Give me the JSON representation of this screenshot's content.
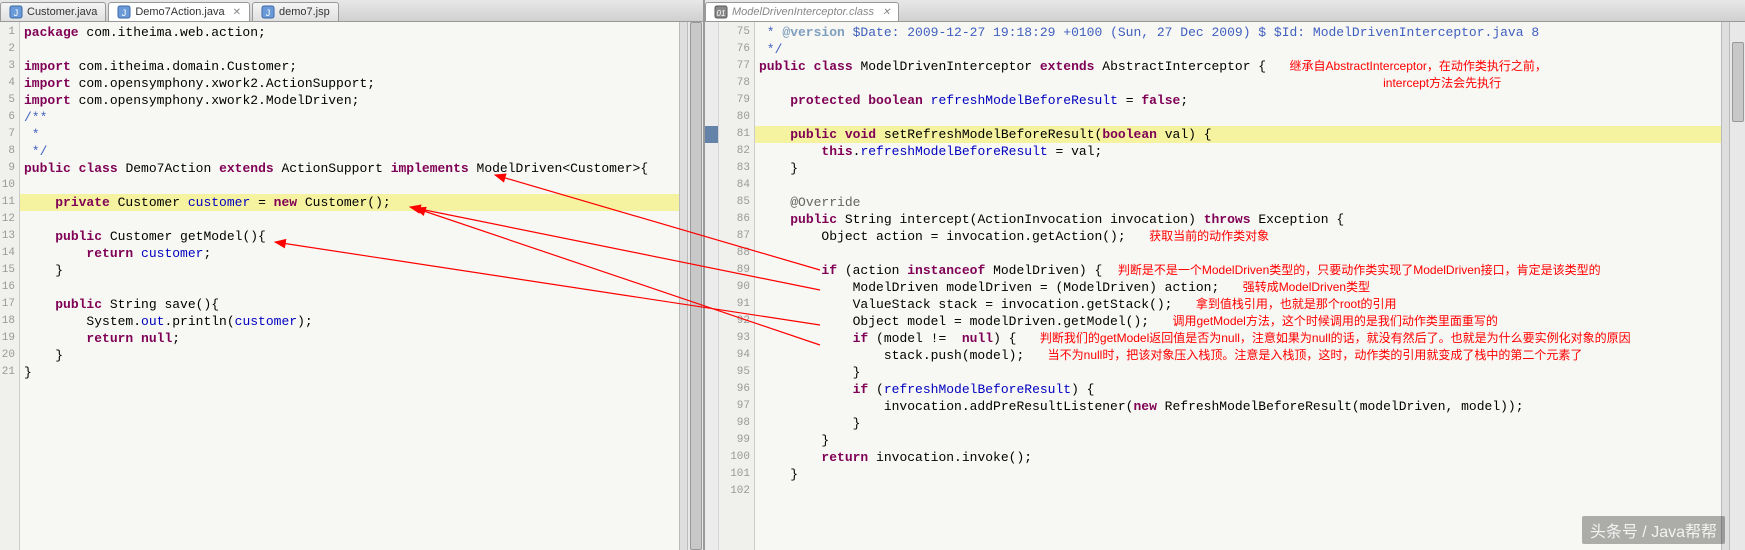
{
  "tabs_left": [
    {
      "label": "Customer.java",
      "active": false
    },
    {
      "label": "Demo7Action.java",
      "active": true
    },
    {
      "label": "demo7.jsp",
      "active": false
    }
  ],
  "tabs_right": [
    {
      "label": "ModelDrivenInterceptor.class",
      "active": true
    }
  ],
  "left_start_line": 1,
  "right_start_line": 75,
  "left_lines": [
    [
      [
        "kw",
        "package"
      ],
      [
        "",
        " com.itheima.web.action;"
      ]
    ],
    [],
    [
      [
        "kw",
        "import"
      ],
      [
        "",
        " com.itheima.domain.Customer;"
      ]
    ],
    [
      [
        "kw",
        "import"
      ],
      [
        "",
        " com.opensymphony.xwork2.ActionSupport;"
      ]
    ],
    [
      [
        "kw",
        "import"
      ],
      [
        "",
        " com.opensymphony.xwork2.ModelDriven;"
      ]
    ],
    [
      [
        "doc",
        "/**"
      ]
    ],
    [
      [
        "doc",
        " *"
      ]
    ],
    [
      [
        "doc",
        " */"
      ]
    ],
    [
      [
        "kw",
        "public"
      ],
      [
        "",
        " "
      ],
      [
        "kw",
        "class"
      ],
      [
        "",
        " Demo7Action "
      ],
      [
        "kw",
        "extends"
      ],
      [
        "",
        " ActionSupport "
      ],
      [
        "kw",
        "implements"
      ],
      [
        "",
        " ModelDriven<Customer>{"
      ]
    ],
    [],
    [
      [
        "",
        "    "
      ],
      [
        "kw",
        "private"
      ],
      [
        "",
        " Customer "
      ],
      [
        "fld",
        "customer"
      ],
      [
        "",
        " = "
      ],
      [
        "kw",
        "new"
      ],
      [
        "",
        " Customer();"
      ]
    ],
    [],
    [
      [
        "",
        "    "
      ],
      [
        "kw",
        "public"
      ],
      [
        "",
        " Customer getModel(){"
      ]
    ],
    [
      [
        "",
        "        "
      ],
      [
        "kw",
        "return"
      ],
      [
        "",
        " "
      ],
      [
        "fld",
        "customer"
      ],
      [
        "",
        ";"
      ]
    ],
    [
      [
        "",
        "    }"
      ]
    ],
    [],
    [
      [
        "",
        "    "
      ],
      [
        "kw",
        "public"
      ],
      [
        "",
        " String save(){"
      ]
    ],
    [
      [
        "",
        "        System."
      ],
      [
        "fld",
        "out"
      ],
      [
        "",
        ".println("
      ],
      [
        "fld",
        "customer"
      ],
      [
        "",
        ");"
      ]
    ],
    [
      [
        "",
        "        "
      ],
      [
        "kw",
        "return"
      ],
      [
        "",
        " "
      ],
      [
        "kw",
        "null"
      ],
      [
        "",
        ";"
      ]
    ],
    [
      [
        "",
        "    }"
      ]
    ],
    [
      [
        "",
        "}"
      ]
    ]
  ],
  "left_hl": [
    11
  ],
  "right_lines": [
    [
      [
        "doc",
        " * "
      ],
      [
        "doctag",
        "@version"
      ],
      [
        "doc",
        " $Date: 2009-12-27 19:18:29 +0100 (Sun, 27 Dec 2009) $ $Id: ModelDrivenInterceptor.java 8"
      ]
    ],
    [
      [
        "doc",
        " */"
      ]
    ],
    [
      [
        "kw",
        "public"
      ],
      [
        "",
        " "
      ],
      [
        "kw",
        "class"
      ],
      [
        "",
        " ModelDrivenInterceptor "
      ],
      [
        "kw",
        "extends"
      ],
      [
        "",
        " AbstractInterceptor {   "
      ],
      [
        "ann-red",
        "继承自AbstractInterceptor，在动作类执行之前，"
      ]
    ],
    [
      [
        "",
        "                                                                                "
      ],
      [
        "ann-red",
        "intercept方法会先执行"
      ]
    ],
    [
      [
        "",
        "    "
      ],
      [
        "kw",
        "protected"
      ],
      [
        "",
        " "
      ],
      [
        "kw",
        "boolean"
      ],
      [
        "",
        " "
      ],
      [
        "fld",
        "refreshModelBeforeResult"
      ],
      [
        "",
        " = "
      ],
      [
        "kw",
        "false"
      ],
      [
        "",
        ";"
      ]
    ],
    [],
    [
      [
        "",
        "    "
      ],
      [
        "kw",
        "public"
      ],
      [
        "",
        " "
      ],
      [
        "kw",
        "void"
      ],
      [
        "",
        " setRefreshModelBeforeResult("
      ],
      [
        "kw",
        "boolean"
      ],
      [
        "",
        " val) {"
      ]
    ],
    [
      [
        "",
        "        "
      ],
      [
        "kw",
        "this"
      ],
      [
        "",
        "."
      ],
      [
        "fld",
        "refreshModelBeforeResult"
      ],
      [
        "",
        " = val;"
      ]
    ],
    [
      [
        "",
        "    }"
      ]
    ],
    [],
    [
      [
        "",
        "    "
      ],
      [
        "ov",
        "@Override"
      ]
    ],
    [
      [
        "",
        "    "
      ],
      [
        "kw",
        "public"
      ],
      [
        "",
        " String intercept(ActionInvocation invocation) "
      ],
      [
        "kw",
        "throws"
      ],
      [
        "",
        " Exception {"
      ]
    ],
    [
      [
        "",
        "        Object action = invocation.getAction();   "
      ],
      [
        "ann-red",
        "获取当前的动作类对象"
      ]
    ],
    [],
    [
      [
        "",
        "        "
      ],
      [
        "kw",
        "if"
      ],
      [
        "",
        " (action "
      ],
      [
        "kw",
        "instanceof"
      ],
      [
        "",
        " ModelDriven) {  "
      ],
      [
        "ann-red",
        "判断是不是一个ModelDriven类型的，只要动作类实现了ModelDriven接口，肯定是该类型的"
      ]
    ],
    [
      [
        "",
        "            ModelDriven modelDriven = (ModelDriven) action;   "
      ],
      [
        "ann-red",
        "强转成ModelDriven类型"
      ]
    ],
    [
      [
        "",
        "            ValueStack stack = invocation.getStack();   "
      ],
      [
        "ann-red",
        "拿到值栈引用，也就是那个root的引用"
      ]
    ],
    [
      [
        "",
        "            Object model = modelDriven.getModel();   "
      ],
      [
        "ann-red",
        "调用getModel方法，这个时候调用的是我们动作类里面重写的"
      ]
    ],
    [
      [
        "",
        "            "
      ],
      [
        "kw",
        "if"
      ],
      [
        "",
        " (model !=  "
      ],
      [
        "kw",
        "null"
      ],
      [
        "",
        ") {   "
      ],
      [
        "ann-red",
        "判断我们的getModel返回值是否为null，注意如果为null的话，就没有然后了。也就是为什么要实例化对象的原因"
      ]
    ],
    [
      [
        "",
        "                stack.push(model);   "
      ],
      [
        "ann-red",
        "当不为null时，把该对象压入栈顶。注意是入栈顶，这时，动作类的引用就变成了栈中的第二个元素了"
      ]
    ],
    [
      [
        "",
        "            }"
      ]
    ],
    [
      [
        "",
        "            "
      ],
      [
        "kw",
        "if"
      ],
      [
        "",
        " ("
      ],
      [
        "fld",
        "refreshModelBeforeResult"
      ],
      [
        "",
        ") {"
      ]
    ],
    [
      [
        "",
        "                invocation.addPreResultListener("
      ],
      [
        "kw",
        "new"
      ],
      [
        "",
        " RefreshModelBeforeResult(modelDriven, model));"
      ]
    ],
    [
      [
        "",
        "            }"
      ]
    ],
    [
      [
        "",
        "        }"
      ]
    ],
    [
      [
        "",
        "        "
      ],
      [
        "kw",
        "return"
      ],
      [
        "",
        " invocation.invoke();"
      ]
    ],
    [
      [
        "",
        "    }"
      ]
    ],
    []
  ],
  "right_hl": [
    81
  ],
  "right_marker2": [
    81
  ],
  "watermark": "头条号 / Java帮帮"
}
